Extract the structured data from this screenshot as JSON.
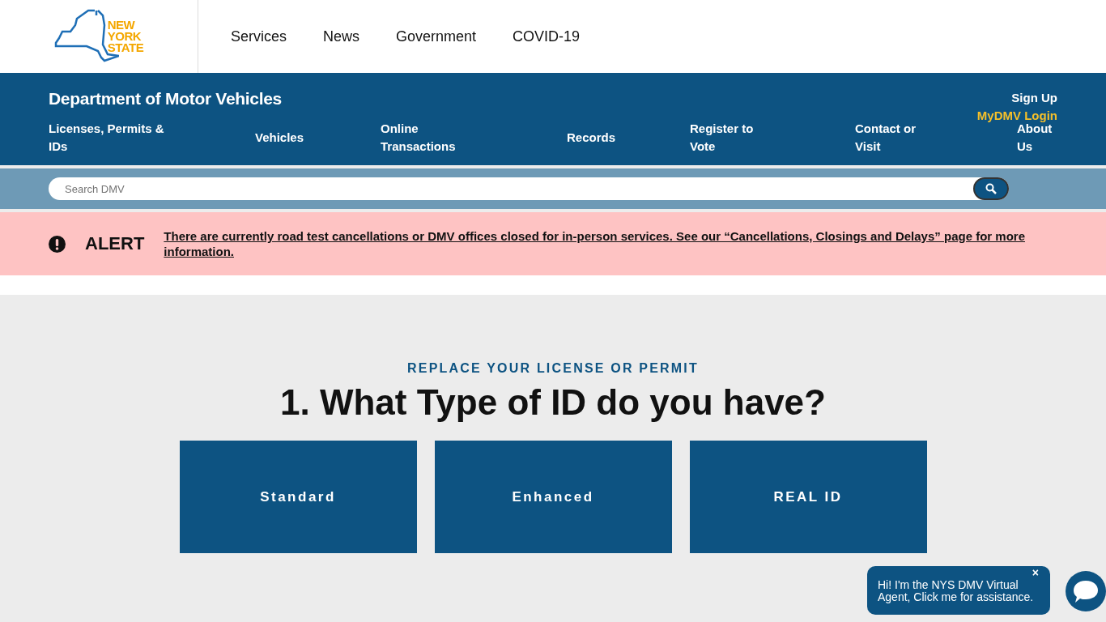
{
  "logo": {
    "lines": [
      "NEW",
      "YORK",
      "STATE"
    ]
  },
  "top_nav": [
    "Services",
    "News",
    "Government",
    "COVID-19"
  ],
  "agency": {
    "title": "Department of Motor Vehicles",
    "login": "MyDMV Login",
    "signup": "Sign Up"
  },
  "agency_nav": [
    "Licenses, Permits & IDs",
    "Vehicles",
    "Online Transactions",
    "Records",
    "Register to Vote",
    "Contact or Visit",
    "About Us"
  ],
  "search": {
    "placeholder": "Search DMV"
  },
  "alert": {
    "label": "ALERT",
    "message": "There are currently road test cancellations or DMV offices closed for in-person services. See our “Cancellations, Closings and Delays” page for more information."
  },
  "section": {
    "eyebrow": "REPLACE YOUR LICENSE OR PERMIT",
    "heading": "1. What Type of ID do you have?",
    "options": [
      "Standard",
      "Enhanced",
      "REAL ID"
    ]
  },
  "chat": {
    "close": "×",
    "message": "Hi! I'm the NYS DMV Virtual Agent, Click me for assistance."
  }
}
